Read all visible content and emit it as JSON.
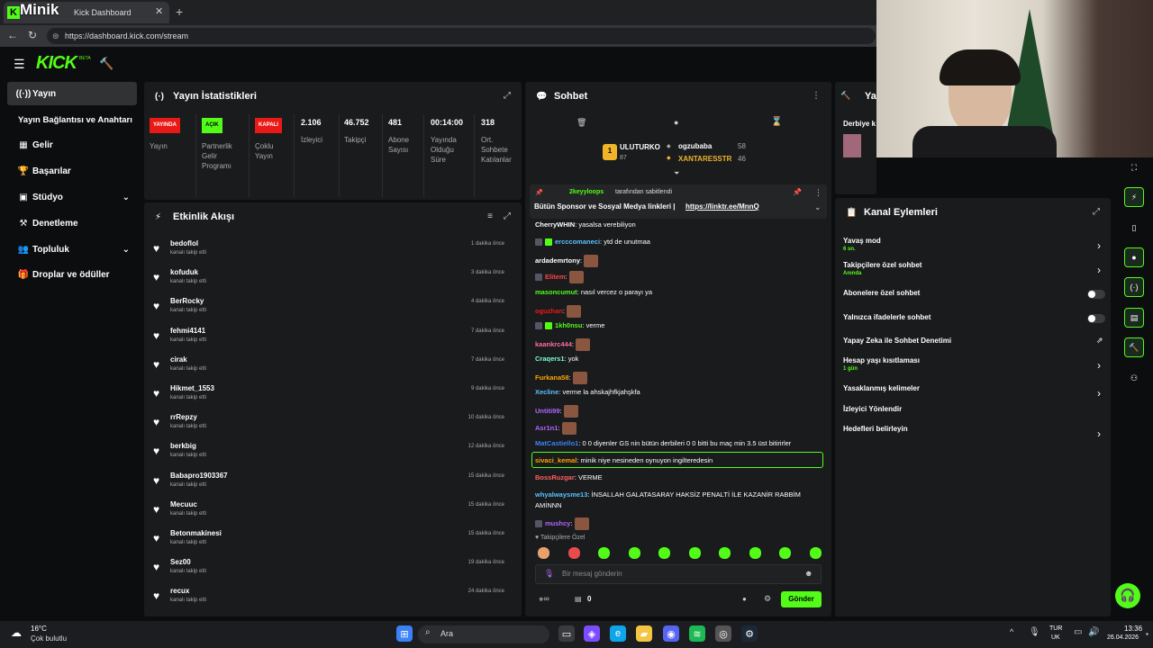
{
  "browser": {
    "tab_title": "Kick Dashboard",
    "overlay_brand": "Minik",
    "url": "https://dashboard.kick.com/stream"
  },
  "brand": {
    "logo": "KICK",
    "beta": "BETA"
  },
  "sidebar": {
    "items": [
      {
        "label": "Yayın",
        "icon": "broadcast-icon"
      },
      {
        "label": "Yayın Bağlantısı ve Anahtarı",
        "icon": ""
      },
      {
        "label": "Gelir",
        "icon": "chart-icon"
      },
      {
        "label": "Başarılar",
        "icon": "trophy-icon"
      },
      {
        "label": "Stüdyo",
        "icon": "studio-icon"
      },
      {
        "label": "Denetleme",
        "icon": "hammer-icon"
      },
      {
        "label": "Topluluk",
        "icon": "people-icon"
      },
      {
        "label": "Droplar ve ödüller",
        "icon": "gift-icon"
      }
    ]
  },
  "stats": {
    "title": "Yayın İstatistikleri",
    "items": [
      {
        "badge": "YAYINDA",
        "badge_color": "#e91916",
        "label": "Yayın"
      },
      {
        "badge": "AÇIK",
        "badge_color": "#53fc18",
        "label": "Partnerlik Gelir Programı"
      },
      {
        "badge": "KAPALI",
        "badge_color": "#e91916",
        "label": "Çoklu Yayın"
      },
      {
        "value": "2.106",
        "label": "İzleyici"
      },
      {
        "value": "46.752",
        "label": "Takipçi"
      },
      {
        "value": "481",
        "label": "Abone Sayısı"
      },
      {
        "value": "00:14:00",
        "label": "Yayında Olduğu Süre"
      },
      {
        "value": "318",
        "label": "Ort. Sohbete Katılanlar"
      }
    ]
  },
  "activity": {
    "title": "Etkinlik Akışı",
    "items": [
      {
        "name": "bedoflol",
        "sub": "kanalı takip etti",
        "time": "1 dakika önce"
      },
      {
        "name": "kofuduk",
        "sub": "kanalı takip etti",
        "time": "3 dakika önce"
      },
      {
        "name": "BerRocky",
        "sub": "kanalı takip etti",
        "time": "4 dakika önce"
      },
      {
        "name": "fehmi4141",
        "sub": "kanalı takip etti",
        "time": "7 dakika önce"
      },
      {
        "name": "cirak",
        "sub": "kanalı takip etti",
        "time": "7 dakika önce"
      },
      {
        "name": "Hikmet_1553",
        "sub": "kanalı takip etti",
        "time": "9 dakika önce"
      },
      {
        "name": "rrRepzy",
        "sub": "kanalı takip etti",
        "time": "10 dakika önce"
      },
      {
        "name": "berkbig",
        "sub": "kanalı takip etti",
        "time": "12 dakika önce"
      },
      {
        "name": "Babapro1903367",
        "sub": "kanalı takip etti",
        "time": "15 dakika önce"
      },
      {
        "name": "Mecuuc",
        "sub": "kanalı takip etti",
        "time": "15 dakika önce"
      },
      {
        "name": "Betonmakinesi",
        "sub": "kanalı takip etti",
        "time": "15 dakika önce"
      },
      {
        "name": "Sez00",
        "sub": "kanalı takip etti",
        "time": "19 dakika önce"
      },
      {
        "name": "recux",
        "sub": "kanalı takip etti",
        "time": "24 dakika önce"
      }
    ]
  },
  "chat": {
    "title": "Sohbet",
    "top": [
      {
        "rank": "1",
        "name": "ULUTURKO",
        "count": "87"
      },
      {
        "name": "ogzubaba",
        "count": "58"
      },
      {
        "name": "XANTARESSTR",
        "count": "46"
      }
    ],
    "pinned": {
      "by": "2keyyloops",
      "by_suffix": "tarafından sabitlendi",
      "text": "Bütün Sponsor ve Sosyal Medya linkleri |",
      "link": "https://linktr.ee/MnnQ"
    },
    "messages": [
      {
        "user": "CherryWHIN",
        "color": "#ffffff",
        "text": "yasalsa verebiliyon"
      },
      {
        "user": "ercccomaneci",
        "color": "#5bc0ff",
        "text": "ytd de unutmaa"
      },
      {
        "user": "ardademrtony",
        "color": "#ffffff",
        "text": ""
      },
      {
        "user": "Elitem",
        "color": "#ff4444",
        "text": ""
      },
      {
        "user": "masoncumut",
        "color": "#53fc18",
        "text": "nasıl vercez o parayı ya"
      },
      {
        "user": "oguzhan",
        "color": "#e91916",
        "text": ""
      },
      {
        "user": "1kh0nsu",
        "color": "#53fc18",
        "text": "verme"
      },
      {
        "user": "kaankrc444",
        "color": "#ff6aa0",
        "text": ""
      },
      {
        "user": "Craqers1",
        "color": "#7fffd4",
        "text": "yok"
      },
      {
        "user": "Furkana58",
        "color": "#ffa500",
        "text": ""
      },
      {
        "user": "Xecline",
        "color": "#5bc0ff",
        "text": "verme la ahskajhfkjahşkfa"
      },
      {
        "user": "Untiti99",
        "color": "#b266ff",
        "text": ""
      },
      {
        "user": "Asr1n1",
        "color": "#b266ff",
        "text": ""
      },
      {
        "user": "MatCastiello1",
        "color": "#3b82f6",
        "text": "0 0 diyenler GS nin bütün derbileri 0 0 bitti bu maç min 3.5 üst bitirirler"
      },
      {
        "user": "sivaci_kemal",
        "color": "#ffa500",
        "text": "minik niye nesineden oynuyon ingilteredesin"
      },
      {
        "user": "BossRuzgar",
        "color": "#ff6060",
        "text": "VERME"
      },
      {
        "user": "whyalwaysme13",
        "color": "#5bc0ff",
        "text": "İNSALLAH GALATASARAY HAKSİZ PENALTİ İLE KAZANİR RABBİM"
      },
      {
        "user": "",
        "color": "#ffffff",
        "text": "AMİNNN"
      },
      {
        "user": "mushcy",
        "color": "#b266ff",
        "text": ""
      }
    ],
    "followers_only": "Takipçilere Özel",
    "input_placeholder": "Bir mesaj gönderin",
    "viewer_count": "0",
    "send": "Gönder"
  },
  "channel": {
    "title": "Kanal Eylemleri",
    "side_title": "Ya",
    "side_subtitle": "Derbiye k",
    "items": [
      {
        "label": "Yavaş mod",
        "sub": "6 sn.",
        "control": "arrow"
      },
      {
        "label": "Takipçilere özel sohbet",
        "sub": "Anında",
        "control": "arrow"
      },
      {
        "label": "Abonelere özel sohbet",
        "sub": "",
        "control": "toggle"
      },
      {
        "label": "Yalnızca ifadelerle sohbet",
        "sub": "",
        "control": "toggle"
      },
      {
        "label": "Yapay Zeka ile Sohbet Denetimi",
        "sub": "",
        "control": "external"
      },
      {
        "label": "Hesap yaşı kısıtlaması",
        "sub": "1 gün",
        "control": "arrow"
      },
      {
        "label": "Yasaklanmış kelimeler",
        "sub": "",
        "control": "arrow"
      },
      {
        "label": "İzleyici Yönlendir",
        "sub": "",
        "control": ""
      },
      {
        "label": "Hedefleri belirleyin",
        "sub": "",
        "control": "arrow"
      }
    ]
  },
  "taskbar": {
    "weather_temp": "16°C",
    "weather_desc": "Çok bulutlu",
    "search": "Ara",
    "lang1": "TUR",
    "lang2": "UK",
    "time": "13:36",
    "date": "26.04.2026"
  },
  "colors": {
    "accent": "#53fc18",
    "live_red": "#e91916",
    "panel": "#191b1d",
    "bg": "#0b0d0e"
  }
}
